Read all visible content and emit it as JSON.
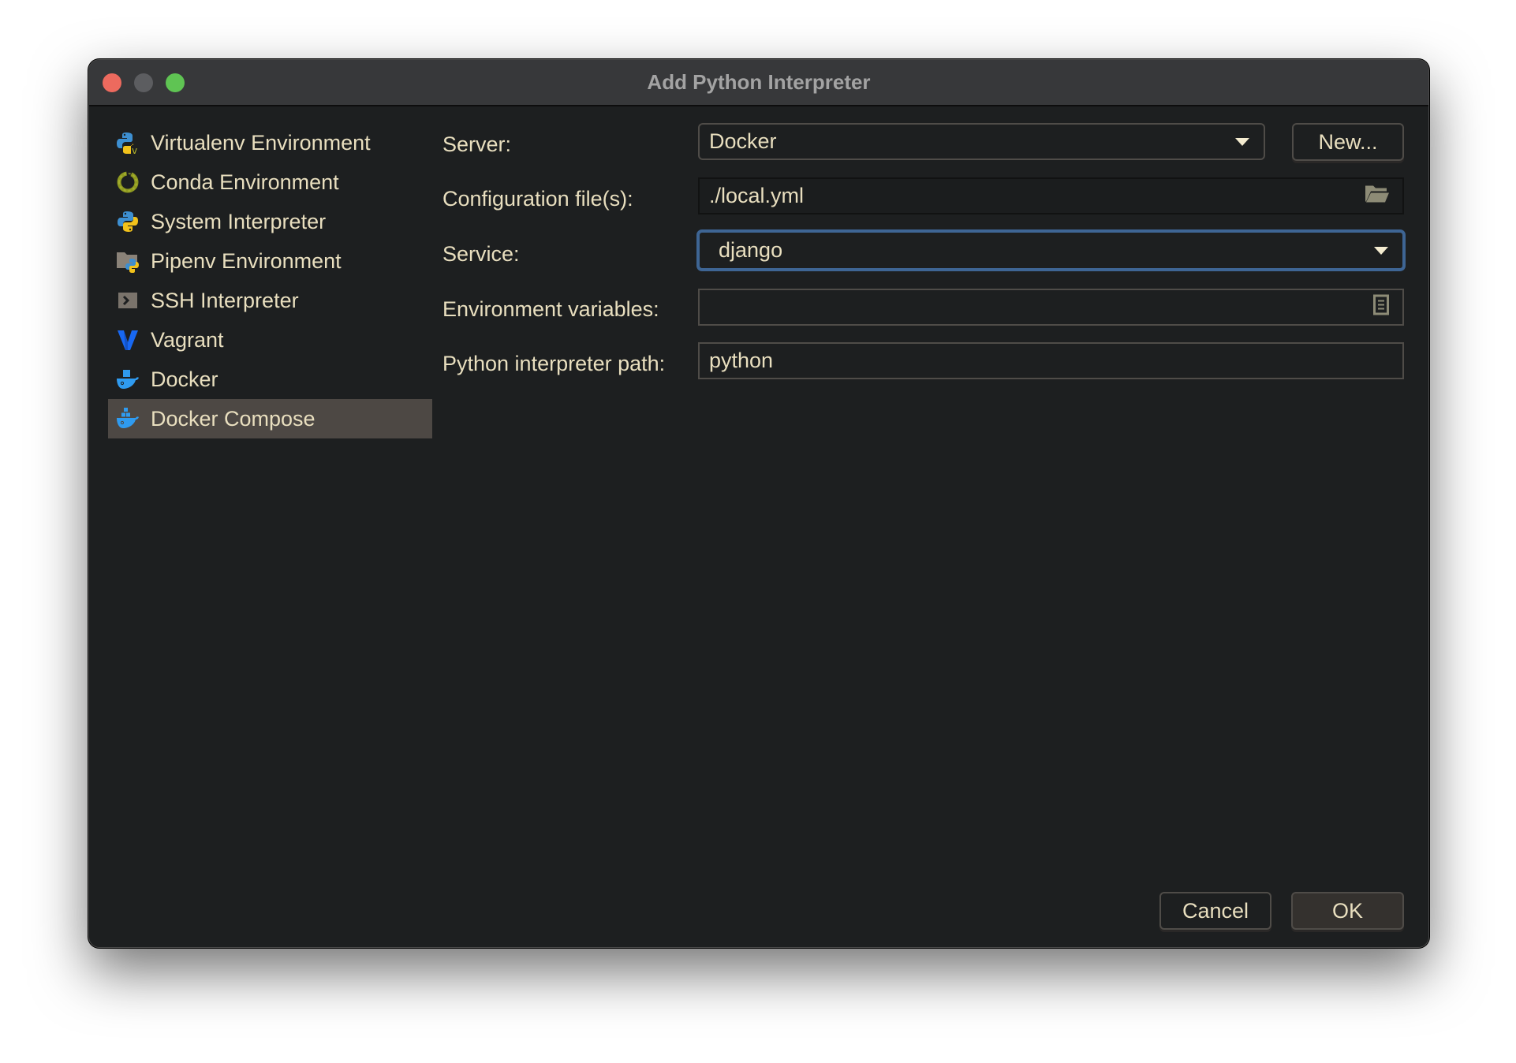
{
  "window": {
    "title": "Add Python Interpreter"
  },
  "sidebar": {
    "items": [
      {
        "label": "Virtualenv Environment",
        "icon": "virtualenv-icon"
      },
      {
        "label": "Conda Environment",
        "icon": "conda-icon"
      },
      {
        "label": "System Interpreter",
        "icon": "python-icon"
      },
      {
        "label": "Pipenv Environment",
        "icon": "pipenv-icon"
      },
      {
        "label": "SSH Interpreter",
        "icon": "ssh-terminal-icon"
      },
      {
        "label": "Vagrant",
        "icon": "vagrant-icon"
      },
      {
        "label": "Docker",
        "icon": "docker-icon"
      },
      {
        "label": "Docker Compose",
        "icon": "docker-compose-icon",
        "selected": true
      }
    ]
  },
  "form": {
    "server": {
      "label": "Server:",
      "value": "Docker",
      "new_button": "New..."
    },
    "config_files": {
      "label": "Configuration file(s):",
      "value": "./local.yml",
      "icon": "folder-open-icon"
    },
    "service": {
      "label": "Service:",
      "value": "django"
    },
    "env_vars": {
      "label": "Environment variables:",
      "value": "",
      "icon": "document-icon"
    },
    "python_path": {
      "label": "Python interpreter path:",
      "value": "python"
    }
  },
  "buttons": {
    "cancel": "Cancel",
    "ok": "OK"
  },
  "colors": {
    "background": "#1d1f20",
    "titlebar": "#37383a",
    "text": "#e9dfbf",
    "selection": "#4d4844",
    "focus_border": "#3e6594"
  }
}
